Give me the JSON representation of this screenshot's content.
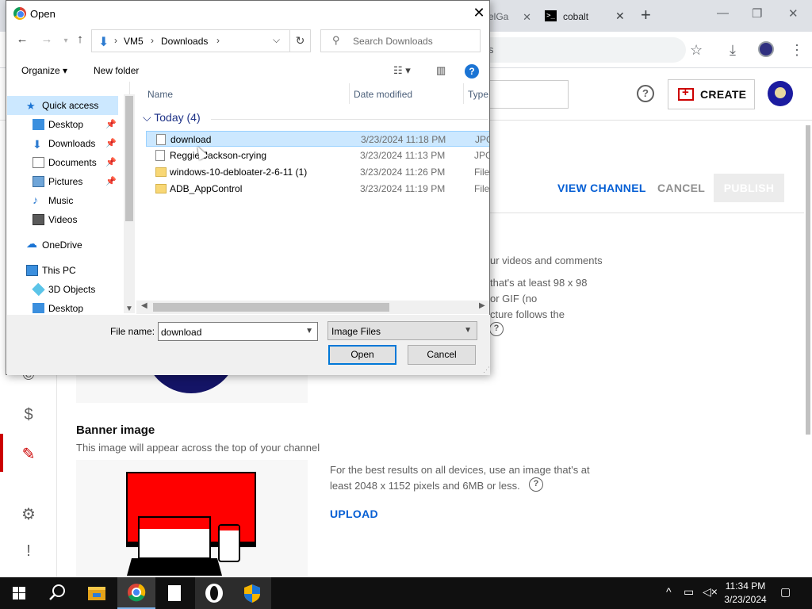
{
  "browser": {
    "tab_partial": "elGa",
    "tab_active": "cobalt",
    "omnibox_partial": "s",
    "new_tab": "+",
    "tab_close": "✕"
  },
  "studio": {
    "create_label": "CREATE",
    "help_label": "?",
    "view_channel": "VIEW CHANNEL",
    "cancel": "CANCEL",
    "publish": "PUBLISH",
    "picture_desc": [
      "ur videos and comments",
      "that's at least 98 x 98",
      "or GIF (no",
      "cture follows the"
    ],
    "banner_title": "Banner image",
    "banner_subtitle": "This image will appear across the top of your channel",
    "banner_desc_1": "For the best results on all devices, use an image that's at",
    "banner_desc_2": "least 2048 x 1152 pixels and 6MB or less.",
    "upload": "UPLOAD",
    "accent_color": "#065fd4",
    "active_color": "#cc0000"
  },
  "dialog": {
    "title": "Open",
    "close": "✕",
    "breadcrumb": [
      "VM5",
      "Downloads"
    ],
    "search_placeholder": "Search Downloads",
    "organize": "Organize",
    "new_folder": "New folder",
    "nav_items": [
      {
        "label": "Quick access",
        "icon": "star-icon",
        "pinned": false,
        "selected": true
      },
      {
        "label": "Desktop",
        "icon": "desktop-folder-icon",
        "pinned": true
      },
      {
        "label": "Downloads",
        "icon": "download-folder-icon",
        "pinned": true
      },
      {
        "label": "Documents",
        "icon": "documents-folder-icon",
        "pinned": true
      },
      {
        "label": "Pictures",
        "icon": "pictures-folder-icon",
        "pinned": true
      },
      {
        "label": "Music",
        "icon": "music-folder-icon",
        "pinned": false
      },
      {
        "label": "Videos",
        "icon": "videos-folder-icon",
        "pinned": false
      },
      {
        "label": "OneDrive",
        "icon": "onedrive-cloud-icon",
        "pinned": false
      },
      {
        "label": "This PC",
        "icon": "computer-icon",
        "pinned": false
      },
      {
        "label": "3D Objects",
        "icon": "3d-objects-icon",
        "pinned": false
      },
      {
        "label": "Desktop",
        "icon": "desktop-folder-icon",
        "pinned": false
      }
    ],
    "columns": {
      "name": "Name",
      "date": "Date modified",
      "type": "Type"
    },
    "group": "Today (4)",
    "files": [
      {
        "name": "download",
        "date": "3/23/2024 11:18 PM",
        "type": "JPG F",
        "kind": "file",
        "selected": true
      },
      {
        "name": "Reggie-Jackson-crying",
        "date": "3/23/2024 11:13 PM",
        "type": "JPG F",
        "kind": "file",
        "selected": false
      },
      {
        "name": "windows-10-debloater-2-6-11 (1)",
        "date": "3/23/2024 11:26 PM",
        "type": "File fo",
        "kind": "folder",
        "selected": false
      },
      {
        "name": "ADB_AppControl",
        "date": "3/23/2024 11:19 PM",
        "type": "File fo",
        "kind": "folder",
        "selected": false
      }
    ],
    "file_name_label": "File name:",
    "file_name_value": "download",
    "file_type_filter": "Image Files",
    "open_button": "Open",
    "cancel_button": "Cancel"
  },
  "taskbar": {
    "time": "11:34 PM",
    "date": "3/23/2024"
  }
}
